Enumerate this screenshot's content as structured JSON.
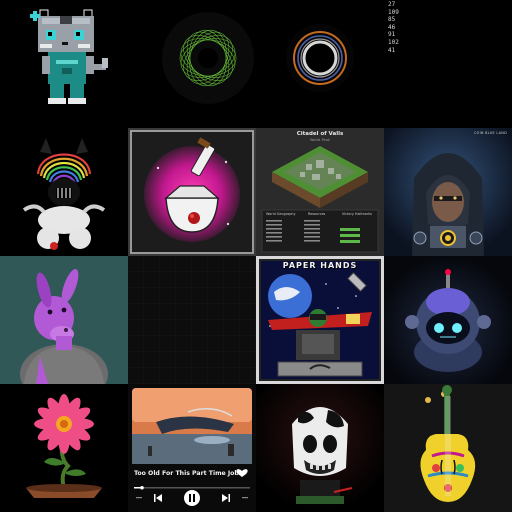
{
  "gallery": {
    "number_list": [
      "27",
      "109",
      "85",
      "46",
      "91",
      "102",
      "41"
    ],
    "citadel": {
      "title": "Citadel of Valls",
      "subtitle": "World Peak",
      "section_world": "World Geography",
      "section_resources": "Resources",
      "section_army": "Victory Hallmarks"
    },
    "paper_hands": {
      "title": "PAPER HANDS"
    },
    "music_player": {
      "song_title": "Too Old For This Part Time Job"
    },
    "crest_tile": {
      "brand": "COIN BLUE LAND"
    }
  },
  "colors": {
    "background": "#000000",
    "pixel_cat_body": "#9aa0a8",
    "pixel_cat_shirt": "#1e8c86",
    "spiral_green": "#6fd13a",
    "potion_magenta": "#c2188e",
    "flower_pink": "#ee4d86",
    "alien_purple": "#b25ad6"
  }
}
